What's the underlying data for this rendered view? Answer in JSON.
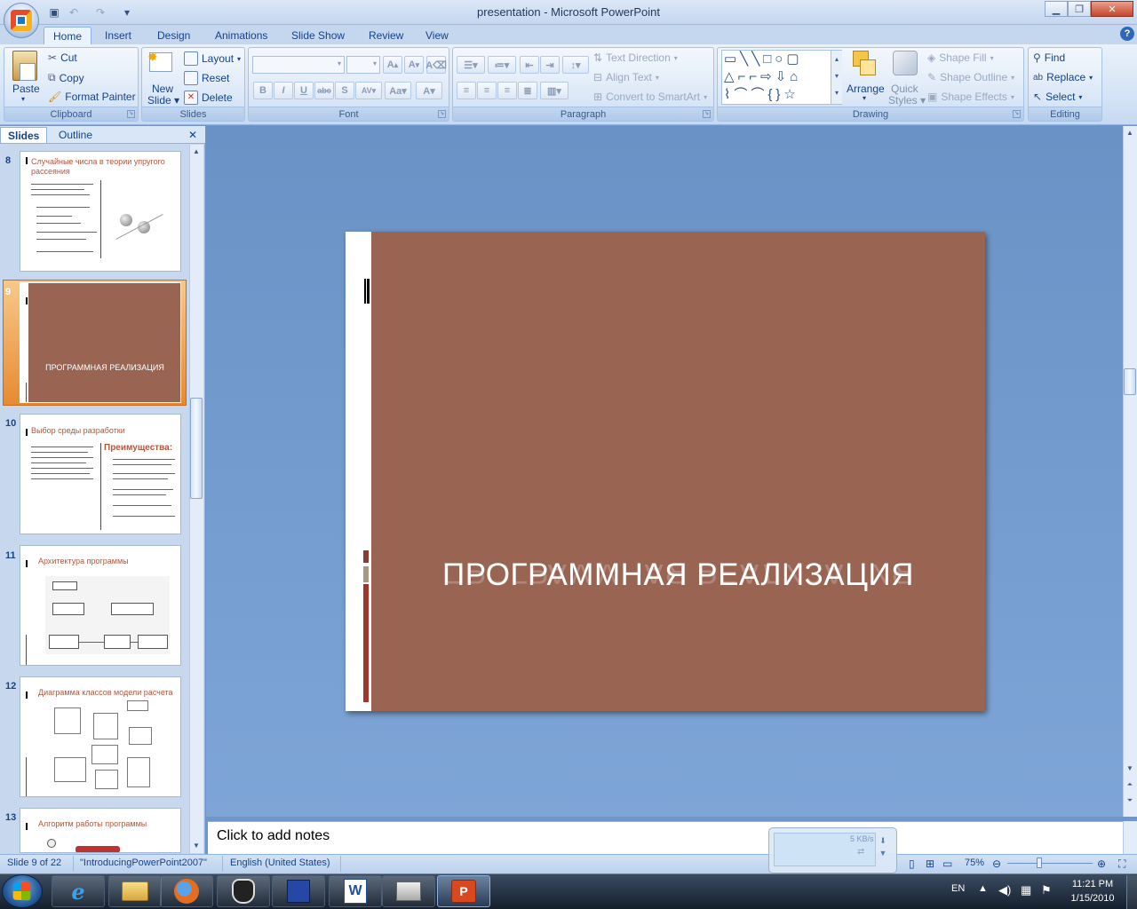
{
  "window": {
    "title": "presentation - Microsoft PowerPoint"
  },
  "ribbon": {
    "tabs": [
      "Home",
      "Insert",
      "Design",
      "Animations",
      "Slide Show",
      "Review",
      "View"
    ],
    "clipboard": {
      "label": "Clipboard",
      "paste": "Paste",
      "cut": "Cut",
      "copy": "Copy",
      "format_painter": "Format Painter"
    },
    "slides": {
      "label": "Slides",
      "new_slide": "New",
      "new_slide2": "Slide",
      "layout": "Layout",
      "reset": "Reset",
      "delete": "Delete"
    },
    "font": {
      "label": "Font"
    },
    "paragraph": {
      "label": "Paragraph",
      "text_direction": "Text Direction",
      "align_text": "Align Text",
      "convert_smartart": "Convert to SmartArt"
    },
    "drawing": {
      "label": "Drawing",
      "arrange": "Arrange",
      "quick_styles": "Quick",
      "quick_styles2": "Styles",
      "shape_fill": "Shape Fill",
      "shape_outline": "Shape Outline",
      "shape_effects": "Shape Effects"
    },
    "editing": {
      "label": "Editing",
      "find": "Find",
      "replace": "Replace",
      "select": "Select"
    }
  },
  "pane": {
    "tabs": {
      "slides": "Slides",
      "outline": "Outline"
    },
    "thumbnails": [
      {
        "num": "8",
        "title": "Случайные числа в теории упругого рассеяния"
      },
      {
        "num": "9",
        "title": "ПРОГРАММНАЯ РЕАЛИЗАЦИЯ"
      },
      {
        "num": "10",
        "title": "Выбор среды разработки",
        "sub": "Преимущества:"
      },
      {
        "num": "11",
        "title": "Архитектура программы"
      },
      {
        "num": "12",
        "title": "Диаграмма классов модели расчета"
      },
      {
        "num": "13",
        "title": "Алгоритм работы программы"
      }
    ]
  },
  "slide": {
    "title": "ПРОГРАММНАЯ РЕАЛИЗАЦИЯ",
    "bg_color": "#996452"
  },
  "notes": {
    "placeholder": "Click to add notes"
  },
  "network": {
    "speed": "5 KB/s"
  },
  "status": {
    "slide": "Slide 9 of 22",
    "theme": "\"IntroducingPowerPoint2007\"",
    "language": "English (United States)",
    "zoom": "75%"
  },
  "taskbar": {
    "lang": "EN",
    "time": "11:21 PM",
    "date": "1/15/2010"
  }
}
